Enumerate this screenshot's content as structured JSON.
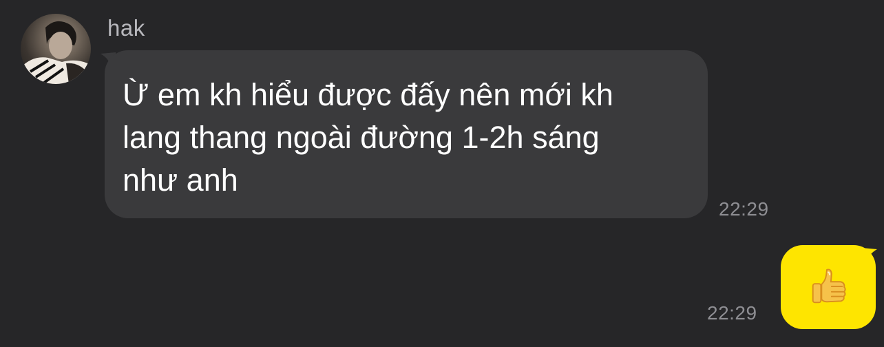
{
  "conversation": {
    "incoming": {
      "sender": "hak",
      "text": "Ừ em kh hiểu được đấy nên mới kh\nlang thang ngoài đường 1-2h sáng\nnhư anh",
      "time": "22:29"
    },
    "outgoing": {
      "content_icon": "thumbs-up-icon",
      "time": "22:29"
    }
  },
  "colors": {
    "background": "#262628",
    "incoming_bubble": "#3a3a3c",
    "outgoing_bubble": "#fee500",
    "timestamp": "#8e8e93"
  }
}
